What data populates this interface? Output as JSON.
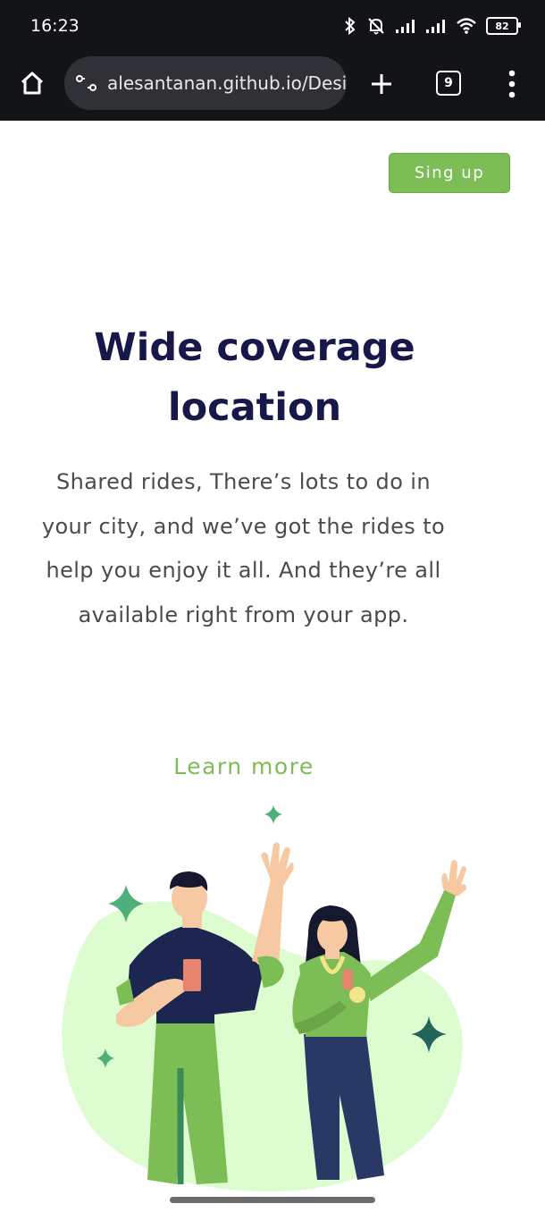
{
  "status_bar": {
    "time": "16:23",
    "battery": "82",
    "icons": [
      "bluetooth-icon",
      "mute-icon",
      "signal-icon",
      "signal-icon",
      "wifi-icon",
      "battery-icon"
    ]
  },
  "browser": {
    "url": "alesantanan.github.io/Desi",
    "tab_count": "9",
    "icons": [
      "home-icon",
      "site-info-icon",
      "plus-icon",
      "tabs-icon",
      "menu-dots-icon"
    ]
  },
  "page": {
    "signup_label": "Sing up",
    "title": "Wide coverage location",
    "description": "Shared rides, There’s lots to do in your city, and we’ve got the rides to help you enjoy it all. And they’re all available right from your app.",
    "learn_more_label": "Learn more"
  },
  "colors": {
    "accent": "#7dbd55",
    "title": "#17184a",
    "body_text": "#4b4b4b",
    "toolbar_bg": "#121418",
    "blob": "#ddfccf"
  }
}
